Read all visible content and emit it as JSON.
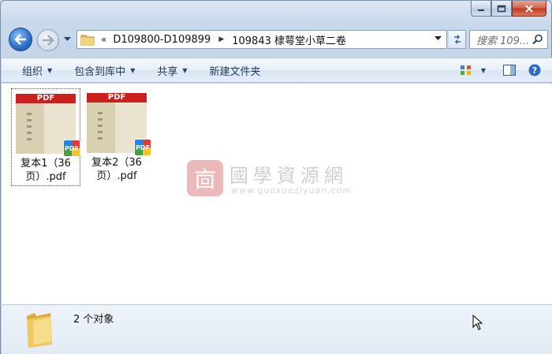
{
  "window": {
    "caption": {
      "minimize": "minimize",
      "maximize": "maximize",
      "close": "close"
    }
  },
  "nav": {
    "breadcrumb_prefix": "«",
    "breadcrumb": [
      "D109800-D109899",
      "109843 棣萼堂小草二卷"
    ],
    "search_placeholder": "搜索 109..."
  },
  "toolbar": {
    "organize": "组织",
    "include_in_library": "包含到库中",
    "share": "共享",
    "new_folder": "新建文件夹"
  },
  "files": [
    {
      "name": "复本1（36页）.pdf",
      "badge": "PDF",
      "header": "PDF",
      "selected": true
    },
    {
      "name": "复本2（36页）.pdf",
      "badge": "PDF",
      "header": "PDF",
      "selected": false
    }
  ],
  "watermark": {
    "logo_char": "㐭",
    "title": "國學資源網",
    "url": "www.guoxueziyuan.com"
  },
  "details": {
    "count": "2 个对象"
  },
  "colors": {
    "pdf_red": "#cc1f1f",
    "accent_blue": "#2a6fc7",
    "toolbar_text": "#1e395b"
  }
}
